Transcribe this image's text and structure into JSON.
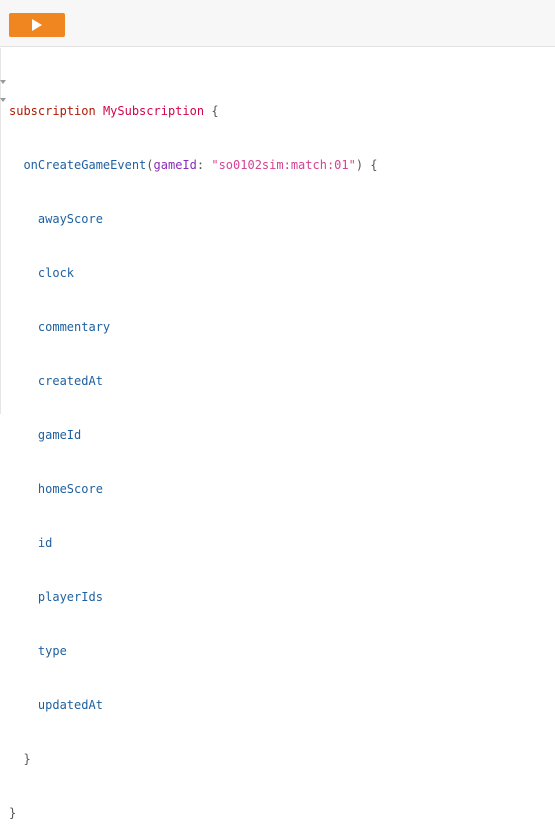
{
  "toolbar": {
    "run_icon": "play-icon",
    "colors": {
      "run_button": "#f0861f",
      "toolbar_bg": "#f7f7f7"
    }
  },
  "editor": {
    "line1": {
      "keyword": "subscription",
      "name": "MySubscription",
      "brace": "{"
    },
    "line2": {
      "field": "onCreateGameEvent",
      "open_paren": "(",
      "arg_name": "gameId",
      "colon": ":",
      "arg_value": "\"so0102sim:match:01\"",
      "close": ") {"
    },
    "fields": [
      "awayScore",
      "clock",
      "commentary",
      "createdAt",
      "gameId",
      "homeScore",
      "id",
      "playerIds",
      "type",
      "updatedAt"
    ],
    "inner_close": "}",
    "outer_close": "}",
    "colors": {
      "keyword": "#b11a04",
      "definition": "#d2054e",
      "field": "#1f61a0",
      "argument": "#8b2bb9",
      "string": "#d64292"
    }
  }
}
